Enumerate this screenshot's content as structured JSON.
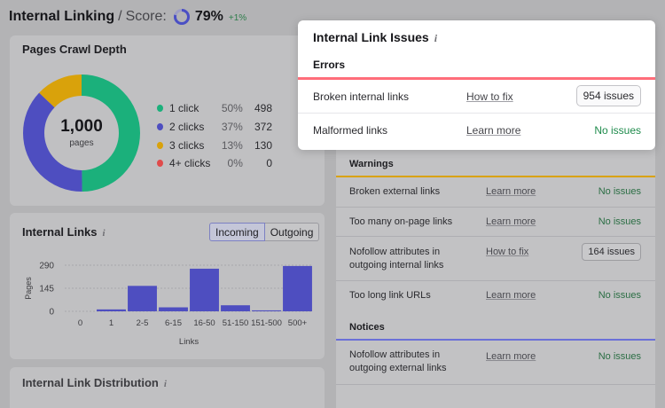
{
  "header": {
    "title": "Internal Linking",
    "separator": "/",
    "score_label": "Score:",
    "score_value": 0.79,
    "score_pct": "79%",
    "score_delta": "+1%",
    "ring_color": "#4a4fc4"
  },
  "crawl_depth": {
    "title": "Pages Crawl Depth",
    "total": "1,000",
    "total_label": "pages",
    "items": [
      {
        "label": "1 click",
        "pct": "50%",
        "count": "498",
        "value": 498,
        "color": "#1bb07b"
      },
      {
        "label": "2 clicks",
        "pct": "37%",
        "count": "372",
        "value": 372,
        "color": "#4e4ec0"
      },
      {
        "label": "3 clicks",
        "pct": "13%",
        "count": "130",
        "value": 130,
        "color": "#d9a20b"
      },
      {
        "label": "4+ clicks",
        "pct": "0%",
        "count": "0",
        "value": 0,
        "color": "#e04b4b"
      }
    ]
  },
  "internal_links": {
    "title": "Internal Links",
    "info_icon": "info-icon",
    "tabs": [
      "Incoming",
      "Outgoing"
    ],
    "active_tab": "Incoming"
  },
  "chart_data": {
    "type": "bar",
    "categories": [
      "0",
      "1",
      "2-5",
      "6-15",
      "16-50",
      "51-150",
      "151-500",
      "500+"
    ],
    "values": [
      0,
      12,
      160,
      25,
      268,
      38,
      6,
      285
    ],
    "xlabel": "Links",
    "ylabel": "Pages",
    "yticks": [
      "0",
      "145",
      "290"
    ],
    "ylim": [
      0,
      290
    ],
    "bar_color": "#4e4ec0"
  },
  "distribution": {
    "title": "Internal Link Distribution"
  },
  "popup": {
    "title": "Internal Link Issues",
    "section": "Errors",
    "section_color": "#ff6d7a",
    "rows": [
      {
        "label": "Broken internal links",
        "action": "How to fix",
        "status": "954 issues"
      },
      {
        "label": "Malformed links",
        "action": "Learn more",
        "status": "No issues"
      }
    ]
  },
  "warnings": {
    "title": "Warnings",
    "color": "#d9a20b",
    "rows": [
      {
        "label": "Broken external links",
        "action": "Learn more",
        "status": "No issues"
      },
      {
        "label": "Too many on-page links",
        "action": "Learn more",
        "status": "No issues"
      },
      {
        "label": "Nofollow attributes in outgoing internal links",
        "action": "How to fix",
        "status": "164 issues"
      },
      {
        "label": "Too long link URLs",
        "action": "Learn more",
        "status": "No issues"
      }
    ]
  },
  "notices": {
    "title": "Notices",
    "color": "#6a70d8",
    "rows": [
      {
        "label": "Nofollow attributes in outgoing external links",
        "action": "Learn more",
        "status": "No issues"
      }
    ]
  }
}
